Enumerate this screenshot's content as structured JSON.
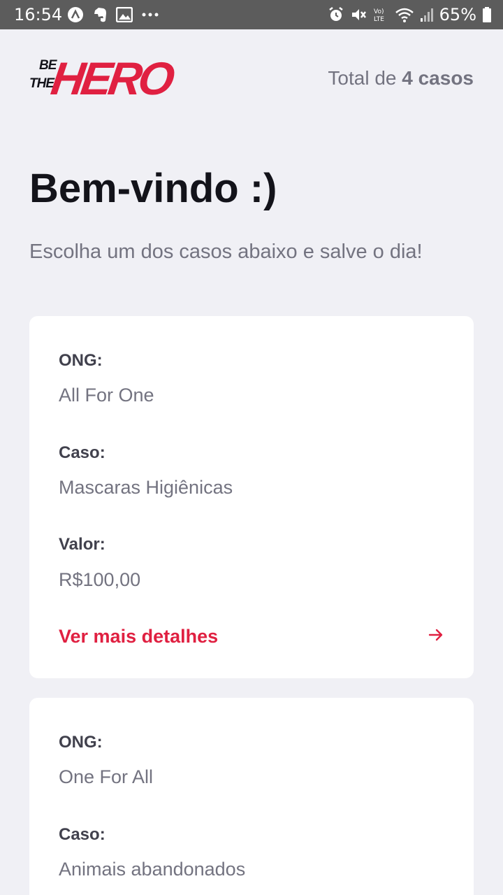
{
  "status_bar": {
    "time": "16:54",
    "battery": "65%"
  },
  "header": {
    "logo": {
      "line1": "BE",
      "line2": "THE",
      "word": "HERO"
    },
    "total_prefix": "Total de ",
    "total_count": "4 casos"
  },
  "title": "Bem-vindo :)",
  "subtitle": "Escolha um dos casos abaixo e salve o dia!",
  "incidents": [
    {
      "ong_label": "ONG:",
      "ong_value": "All For One",
      "caso_label": "Caso:",
      "caso_value": "Mascaras Higiênicas",
      "valor_label": "Valor:",
      "valor_value": "R$100,00",
      "details_label": "Ver mais detalhes"
    },
    {
      "ong_label": "ONG:",
      "ong_value": "One For All",
      "caso_label": "Caso:",
      "caso_value": "Animais abandonados"
    }
  ],
  "colors": {
    "brand": "#e02041",
    "background": "#f0f0f5",
    "card": "#ffffff",
    "text_muted": "#737380",
    "text_strong": "#41414d",
    "status_bar": "#5c5c5c"
  },
  "icons": [
    "assistant-icon",
    "evernote-icon",
    "gallery-icon",
    "more-icon",
    "alarm-icon",
    "mute-icon",
    "volte-icon",
    "wifi-icon",
    "signal-icon",
    "battery-icon",
    "arrow-right-icon"
  ]
}
